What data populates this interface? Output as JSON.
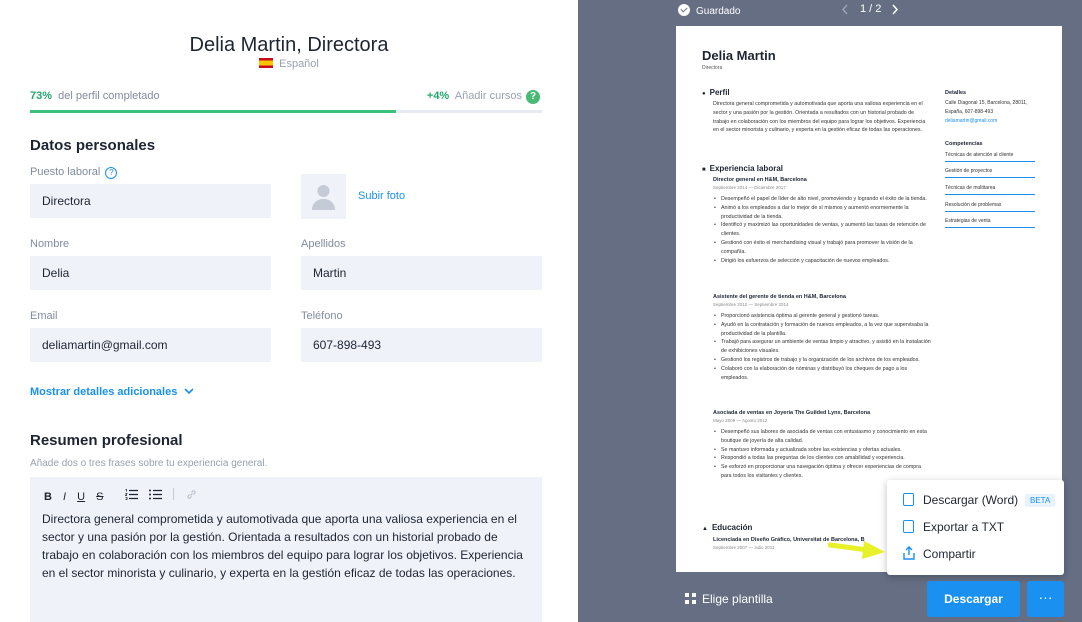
{
  "header": {
    "title": "Delia Martin, Directora",
    "language": "Español"
  },
  "progress": {
    "percent": "73%",
    "label": "del perfil completado",
    "bonus": "+4%",
    "bonus_label": "Añadir cursos",
    "help": "?",
    "fraction": 0.73
  },
  "personal": {
    "heading": "Datos personales",
    "job_label": "Puesto laboral",
    "job_value": "Directora",
    "upload_label": "Subir foto",
    "first_label": "Nombre",
    "first_value": "Delia",
    "last_label": "Apellidos",
    "last_value": "Martin",
    "email_label": "Email",
    "email_value": "deliamartin@gmail.com",
    "phone_label": "Teléfono",
    "phone_value": "607-898-493",
    "more": "Mostrar detalles adicionales"
  },
  "summary": {
    "heading": "Resumen profesional",
    "hint": "Añade dos o tres frases sobre tu experiencia general.",
    "toolbar": [
      "B",
      "I",
      "U",
      "S"
    ],
    "text": "Directora general comprometida y automotivada que aporta una valiosa experiencia en el sector y una pasión por la gestión. Orientada a resultados con un historial probado de trabajo en colaboración con los miembros del equipo para lograr los objetivos. Experiencia en el sector minorista y culinario, y experta en la gestión eficaz de todas las operaciones."
  },
  "preview": {
    "saved": "Guardado",
    "page": "1 / 2",
    "doc": {
      "name": "Delia Martin",
      "role": "Directora",
      "profile_h": "Perfil",
      "profile": "Directora general comprometida y automotivada que aporta una valiosa experiencia en el sector y una pasión por la gestión. Orientada a resultados con un historial probado de trabajo en colaboración con los miembros del equipo para lograr los objetivos. Experiencia en el sector minorista y culinario, y experta en la gestión eficaz de todas las operaciones.",
      "exp_h": "Experiencia laboral",
      "job1_t": "Director general en H&M, Barcelona",
      "job1_d": "Septiembre 2014 — Diciembre 2017",
      "job1": [
        "Desempeñó el papel de líder de alto nivel, promoviendo y logrando el éxito de la tienda.",
        "Animó a los empleados a dar lo mejor de sí mismos y aumentó enormemente la productividad de la tienda.",
        "Identificó y maximizó las oportunidades de ventas, y aumentó las tasas de retención de clientes.",
        "Gestionó con éxito el merchandising visual y trabajó para promover la visión de la compañía.",
        "Dirigió los esfuerzos de selección y capacitación de nuevos empleados."
      ],
      "job2_t": "Asistente del gerente de tienda en H&M, Barcelona",
      "job2_d": "Septiembre 2012 — Septiembre 2014",
      "job2": [
        "Proporcionó asistencia óptima al gerente general y gestionó tareas.",
        "Ayudó en la contratación y formación de nuevos empleados, a la vez que supervisaba la productividad de la plantilla.",
        "Trabajó para asegurar un ambiente de ventas limpio y atractivo, y asistió en la instalación de exhibiciones visuales.",
        "Gestionó los registros de trabajo y la organización de los archivos de los empleados.",
        "Colaboró con la elaboración de nóminas y distribuyó los cheques de pago a los empleados."
      ],
      "job3_t": "Asociada de ventas en Joyería The Guilded Lynx, Barcelona",
      "job3_d": "Mayo 2009 — Agosto 2012",
      "job3": [
        "Desempeñó sus labores de asociada de ventas con entusiasmo y conocimiento en esta boutique de joyería de alta calidad.",
        "Se mantuvo informada y actualizada sobre las existencias y ofertas actuales.",
        "Respondió a todas las preguntas de los clientes con amabilidad y experiencia.",
        "Se esforzó en proporcionar una navegación óptima y ofrecer experiencias de compra para todos los visitantes y clientes."
      ],
      "edu_h": "Educación",
      "edu_t": "Licenciada en Diseño Gráfico, Universitat de Barcelona, B",
      "edu_d": "Septiembre 2007 — Julio 2011",
      "details_h": "Detalles",
      "details": "Calle Diagonal 15, Barcelona, 28011, España, 607-898-493",
      "details_mail": "deliamartin@gmail.com",
      "skills_h": "Competencias",
      "skills": [
        "Técnicas de atención al cliente",
        "Gestión de proyectos",
        "Técnicas de multitarea",
        "Resolución de problemas",
        "Estrategias de venta"
      ]
    },
    "menu": {
      "word": "Descargar (Word)",
      "beta": "BETA",
      "txt": "Exportar a TXT",
      "share": "Compartir"
    },
    "template": "Elige plantilla",
    "download": "Descargar",
    "more": "···"
  },
  "colors": {
    "accent": "#1a91f0",
    "preview_bg": "#656e83",
    "success": "#21a96c",
    "arrow": "#e8f027"
  }
}
